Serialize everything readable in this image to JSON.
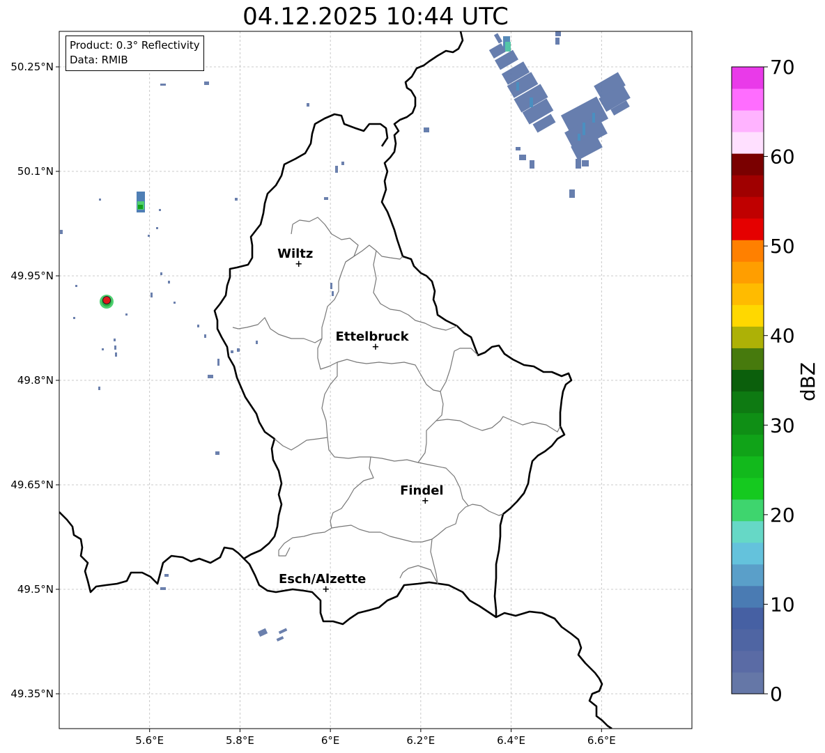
{
  "title": "04.12.2025 10:44 UTC",
  "info": {
    "product": "Product: 0.3° Reflectivity",
    "data": "Data: RMIB"
  },
  "map": {
    "lon_range": [
      5.4,
      6.8
    ],
    "lat_range": [
      49.3,
      50.3
    ],
    "x_ticks": [
      {
        "lon": 5.6,
        "label": "5.6°E"
      },
      {
        "lon": 5.8,
        "label": "5.8°E"
      },
      {
        "lon": 6.0,
        "label": "6°E"
      },
      {
        "lon": 6.2,
        "label": "6.2°E"
      },
      {
        "lon": 6.4,
        "label": "6.4°E"
      },
      {
        "lon": 6.6,
        "label": "6.6°E"
      }
    ],
    "y_ticks": [
      {
        "lat": 50.25,
        "label": "50.25°N"
      },
      {
        "lat": 50.1,
        "label": "50.1°N"
      },
      {
        "lat": 49.95,
        "label": "49.95°N"
      },
      {
        "lat": 49.8,
        "label": "49.8°N"
      },
      {
        "lat": 49.65,
        "label": "49.65°N"
      },
      {
        "lat": 49.5,
        "label": "49.5°N"
      },
      {
        "lat": 49.35,
        "label": "49.35°N"
      }
    ],
    "grid": true,
    "cities": [
      {
        "name": "Wiltz",
        "lon": 5.93,
        "lat": 49.967
      },
      {
        "name": "Ettelbruck",
        "lon": 6.1,
        "lat": 49.848
      },
      {
        "name": "Findel",
        "lon": 6.21,
        "lat": 49.627
      },
      {
        "name": "Esch/Alzette",
        "lon": 5.99,
        "lat": 49.5
      }
    ],
    "radar_site": {
      "lon": 5.505,
      "lat": 49.915,
      "color": "#e0191c"
    }
  },
  "colorbar": {
    "label": "dBZ",
    "min": 0,
    "max": 70,
    "ticks": [
      0,
      10,
      20,
      30,
      40,
      50,
      60,
      70
    ],
    "colors": [
      "#6577a7",
      "#5a6ba5",
      "#4f65a3",
      "#4660a3",
      "#4a7bb3",
      "#5a9fc9",
      "#64c2dc",
      "#66d8c6",
      "#3ed56e",
      "#15c91f",
      "#12b91c",
      "#10a318",
      "#0f8f15",
      "#0e7a12",
      "#0b5f0c",
      "#477a0d",
      "#adb106",
      "#ffd800",
      "#ffbb00",
      "#ff9e00",
      "#ff8000",
      "#e50000",
      "#c00000",
      "#a00000",
      "#7a0000",
      "#ffe0ff",
      "#ffb3ff",
      "#ff6dff",
      "#e93ae9"
    ]
  }
}
